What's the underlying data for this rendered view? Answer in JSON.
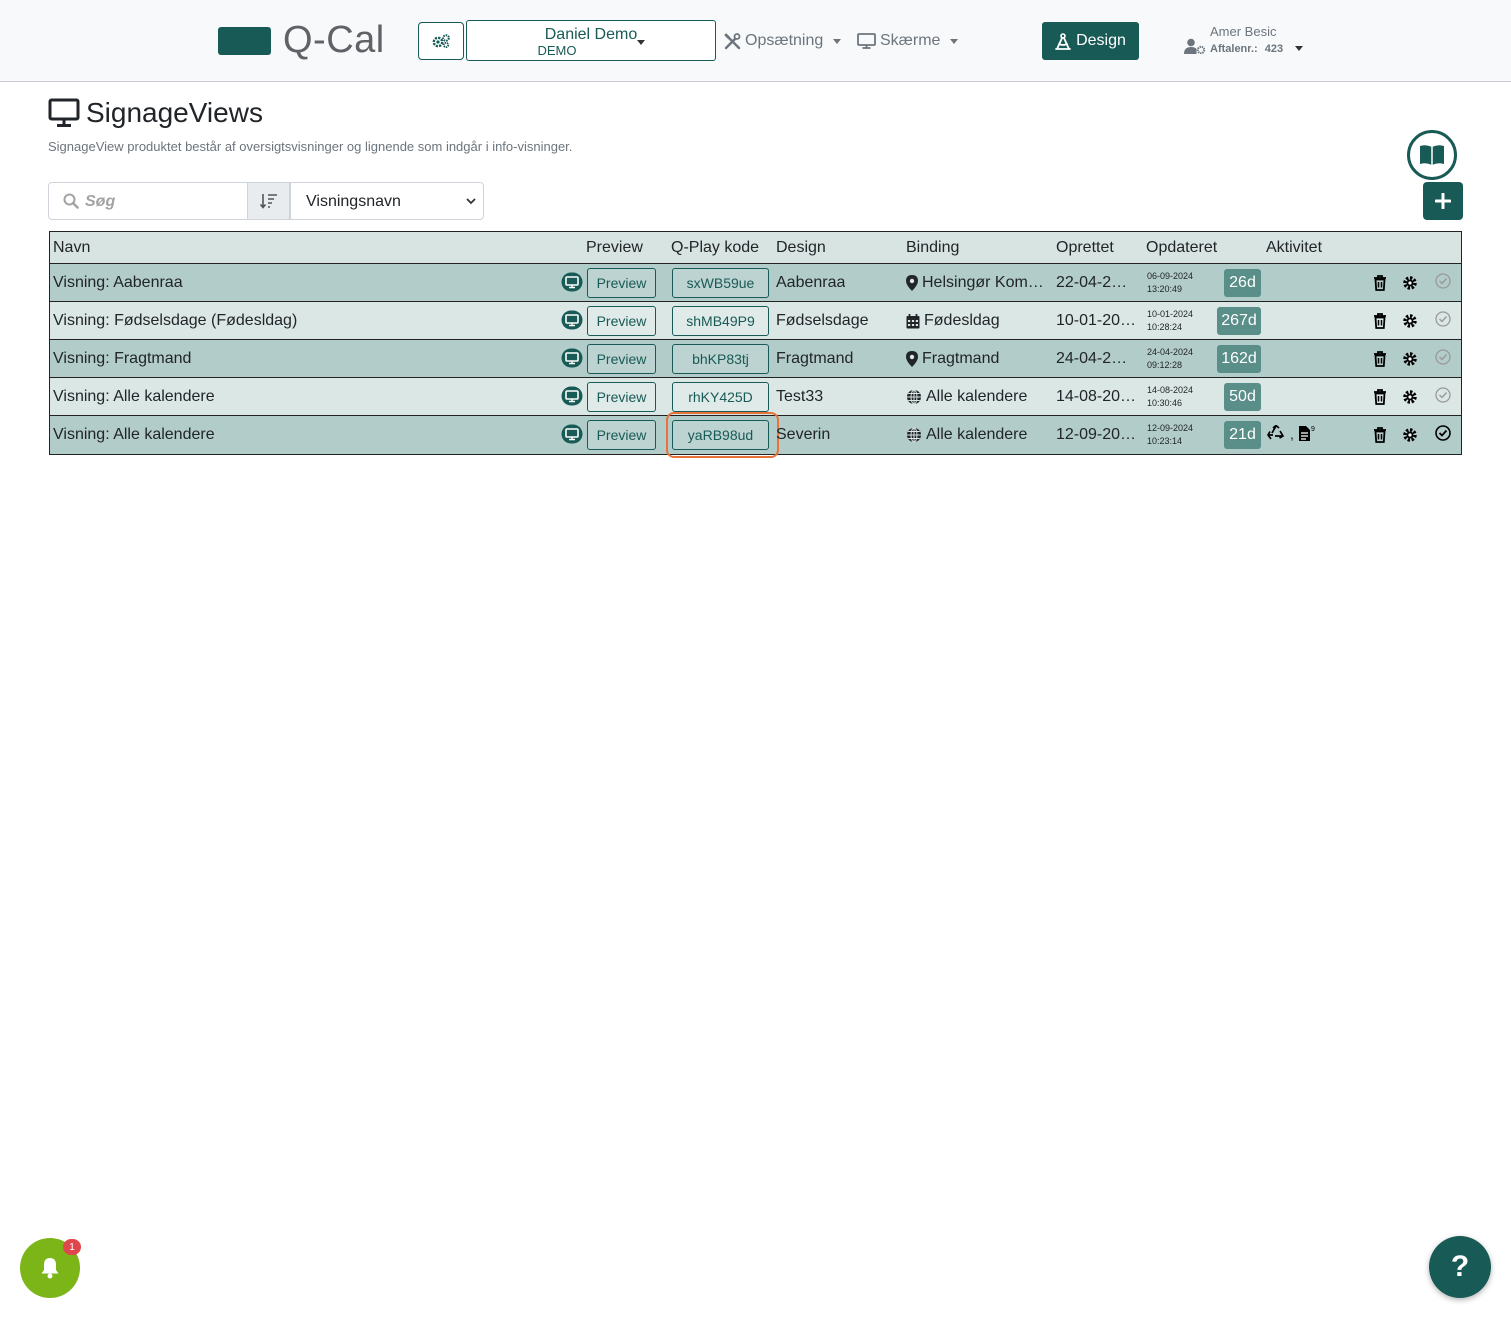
{
  "app": {
    "logo_text": "Q-Cal",
    "brand_color": "#185a55",
    "account": {
      "name": "Daniel Demo",
      "sub": "DEMO"
    },
    "nav": {
      "opsaetning": "Opsætning",
      "skaerme": "Skærme",
      "design": "Design"
    },
    "user": {
      "name": "Amer Besic",
      "sub_label": "Aftalenr.:",
      "sub_value": "423"
    }
  },
  "page": {
    "title": "SignageViews",
    "description": "SignageView produktet består af oversigtsvisninger og lignende som indgår i info-visninger."
  },
  "search": {
    "placeholder": "Søg",
    "value": ""
  },
  "sort": {
    "selected": "Visningsnavn"
  },
  "table": {
    "headers": {
      "navn": "Navn",
      "preview": "Preview",
      "qplay": "Q-Play kode",
      "design": "Design",
      "binding": "Binding",
      "oprettet": "Oprettet",
      "opdateret": "Opdateret",
      "aktivitet": "Aktivitet"
    },
    "rows": [
      {
        "name": "Visning: Aabenraa",
        "preview": "Preview",
        "code": "sxWB59ue",
        "design": "Aabenraa",
        "binding_icon": "map-marker-icon",
        "binding": "Helsingør Kom…",
        "created": "22-04-2…",
        "upd_date": "06-09-2024",
        "upd_time": "13:20:49",
        "days": "26d",
        "active": false,
        "activity": []
      },
      {
        "name": "Visning: Fødselsdage (Fødesldag)",
        "preview": "Preview",
        "code": "shMB49P9",
        "design": "Fødselsdage",
        "binding_icon": "calendar-icon",
        "binding": "Fødesldag",
        "created": "10-01-20…",
        "upd_date": "10-01-2024",
        "upd_time": "10:28:24",
        "days": "267d",
        "active": false,
        "activity": []
      },
      {
        "name": "Visning: Fragtmand",
        "preview": "Preview",
        "code": "bhKP83tj",
        "design": "Fragtmand",
        "binding_icon": "map-marker-icon",
        "binding": "Fragtmand",
        "created": "24-04-2…",
        "upd_date": "24-04-2024",
        "upd_time": "09:12:28",
        "days": "162d",
        "active": false,
        "activity": []
      },
      {
        "name": "Visning: Alle kalendere",
        "preview": "Preview",
        "code": "rhKY425D",
        "design": "Test33",
        "binding_icon": "globe-icon",
        "binding": "Alle kalendere",
        "created": "14-08-20…",
        "upd_date": "14-08-2024",
        "upd_time": "10:30:46",
        "days": "50d",
        "active": false,
        "activity": []
      },
      {
        "name": "Visning: Alle kalendere",
        "preview": "Preview",
        "code": "yaRB98ud",
        "design": "Severin",
        "binding_icon": "globe-icon",
        "binding": "Alle kalendere",
        "created": "12-09-20…",
        "upd_date": "12-09-2024",
        "upd_time": "10:23:14",
        "days": "21d",
        "active": true,
        "activity": [
          "recycle-icon",
          "document-icon"
        ],
        "activity_sup": "9",
        "highlighted": true
      }
    ]
  },
  "notifications": {
    "badge": "1"
  },
  "help": {
    "label": "?"
  }
}
